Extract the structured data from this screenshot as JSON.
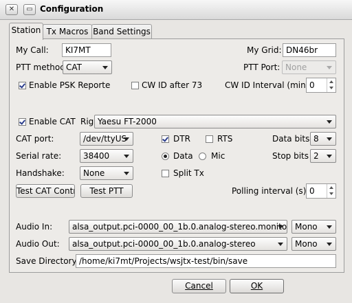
{
  "window": {
    "title": "Configuration"
  },
  "tabs": [
    "Station",
    "Tx Macros",
    "Band Settings"
  ],
  "station": {
    "my_call_label": "My Call:",
    "my_call_value": "KI7MT",
    "my_grid_label": "My Grid:",
    "my_grid_value": "DN46br",
    "ptt_method_label": "PTT methoc",
    "ptt_method_value": "CAT",
    "ptt_port_label": "PTT Port:",
    "ptt_port_value": "None",
    "enable_psk_label": "Enable PSK Reporte",
    "enable_psk_checked": true,
    "cw_id_after_label": "CW ID after 73",
    "cw_id_after_checked": false,
    "cw_interval_label": "CW ID Interval (min):",
    "cw_interval_value": "0",
    "enable_cat_label": "Enable CAT",
    "enable_cat_checked": true,
    "rig_label": "Rig",
    "rig_value": "Yaesu FT-2000",
    "cat_port_label": "CAT port:",
    "cat_port_value": "/dev/ttyUS",
    "dtr_label": "DTR",
    "dtr_checked": true,
    "rts_label": "RTS",
    "rts_checked": false,
    "data_bits_label": "Data bits",
    "data_bits_value": "8",
    "serial_rate_label": "Serial rate:",
    "serial_rate_value": "38400",
    "data_label": "Data",
    "data_selected": true,
    "mic_label": "Mic",
    "mic_selected": false,
    "stop_bits_label": "Stop bits",
    "stop_bits_value": "2",
    "handshake_label": "Handshake:",
    "handshake_value": "None",
    "split_tx_label": "Split Tx",
    "split_tx_checked": false,
    "test_cat_label": "Test CAT Contro",
    "test_ptt_label": "Test PTT",
    "polling_label": "Polling interval (s):",
    "polling_value": "0",
    "audio_in_label": "Audio In:",
    "audio_in_value": "alsa_output.pci-0000_00_1b.0.analog-stereo.monitor",
    "audio_in_channel": "Mono",
    "audio_out_label": "Audio Out:",
    "audio_out_value": "alsa_output.pci-0000_00_1b.0.analog-stereo",
    "audio_out_channel": "Mono",
    "save_dir_label": "Save Directory:",
    "save_dir_value": "/home/ki7mt/Projects/wsjtx-test/bin/save"
  },
  "footer": {
    "cancel_label": "Cancel",
    "ok_label": "OK"
  }
}
